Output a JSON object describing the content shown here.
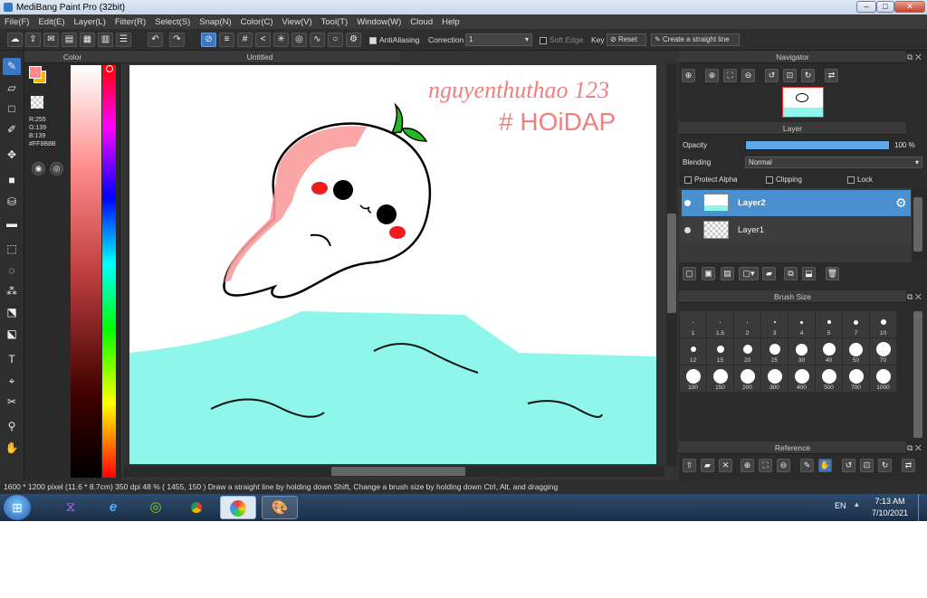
{
  "window": {
    "title": "MediBang Paint Pro (32bit)",
    "minimize": "–",
    "maximize": "□",
    "close": "✕"
  },
  "menu": [
    "File(F)",
    "Edit(E)",
    "Layer(L)",
    "Filter(R)",
    "Select(S)",
    "Snap(N)",
    "Color(C)",
    "View(V)",
    "Tool(T)",
    "Window(W)",
    "Cloud",
    "Help"
  ],
  "toolbar": {
    "antialiasing_label": "AntiAliasing",
    "correction_label": "Correction",
    "correction_value": "1",
    "soft_edge_label": "Soft Edge",
    "key_label": "Key",
    "reset_label": "Reset",
    "straight_line_label": "Create a straight line"
  },
  "color_panel": {
    "title": "Color",
    "r": "R:255",
    "g": "G:139",
    "b": "B:139",
    "hex": "#FF8B8B",
    "primary_color": "#ff8b8b",
    "secondary_color": "#f5b400"
  },
  "canvas": {
    "tab_title": "Untitled",
    "handwriting_line1": "nguyenthuthao 123",
    "handwriting_line2": "# HOiDAP"
  },
  "navigator": {
    "title": "Navigator"
  },
  "layer_panel": {
    "title": "Layer",
    "opacity_label": "Opacity",
    "opacity_value": "100 %",
    "opacity_fraction": 1.0,
    "blending_label": "Blending",
    "blending_value": "Normal",
    "protect_alpha_label": "Protect Alpha",
    "clipping_label": "Clipping",
    "lock_label": "Lock",
    "layers": [
      {
        "name": "Layer2",
        "selected": true
      },
      {
        "name": "Layer1",
        "selected": false
      }
    ]
  },
  "brush_size": {
    "title": "Brush Size",
    "sizes": [
      "1",
      "1.5",
      "2",
      "3",
      "4",
      "5",
      "7",
      "10",
      "12",
      "15",
      "20",
      "25",
      "30",
      "40",
      "50",
      "70",
      "100",
      "150",
      "200",
      "300",
      "400",
      "500",
      "700",
      "1000"
    ]
  },
  "reference": {
    "title": "Reference"
  },
  "status": {
    "text": "1600 * 1200 pixel   (11.6 * 8.7cm)   350 dpi   48 %   ( 1455, 150 )   Draw a straight line by holding down Shift, Change a brush size by holding down Ctrl, Alt, and dragging"
  },
  "taskbar": {
    "language": "EN",
    "time": "7:13 AM",
    "date": "7/10/2021",
    "apps": [
      "visual-studio",
      "internet-explorer",
      "green-app",
      "chrome",
      "medibang",
      "paint"
    ]
  }
}
